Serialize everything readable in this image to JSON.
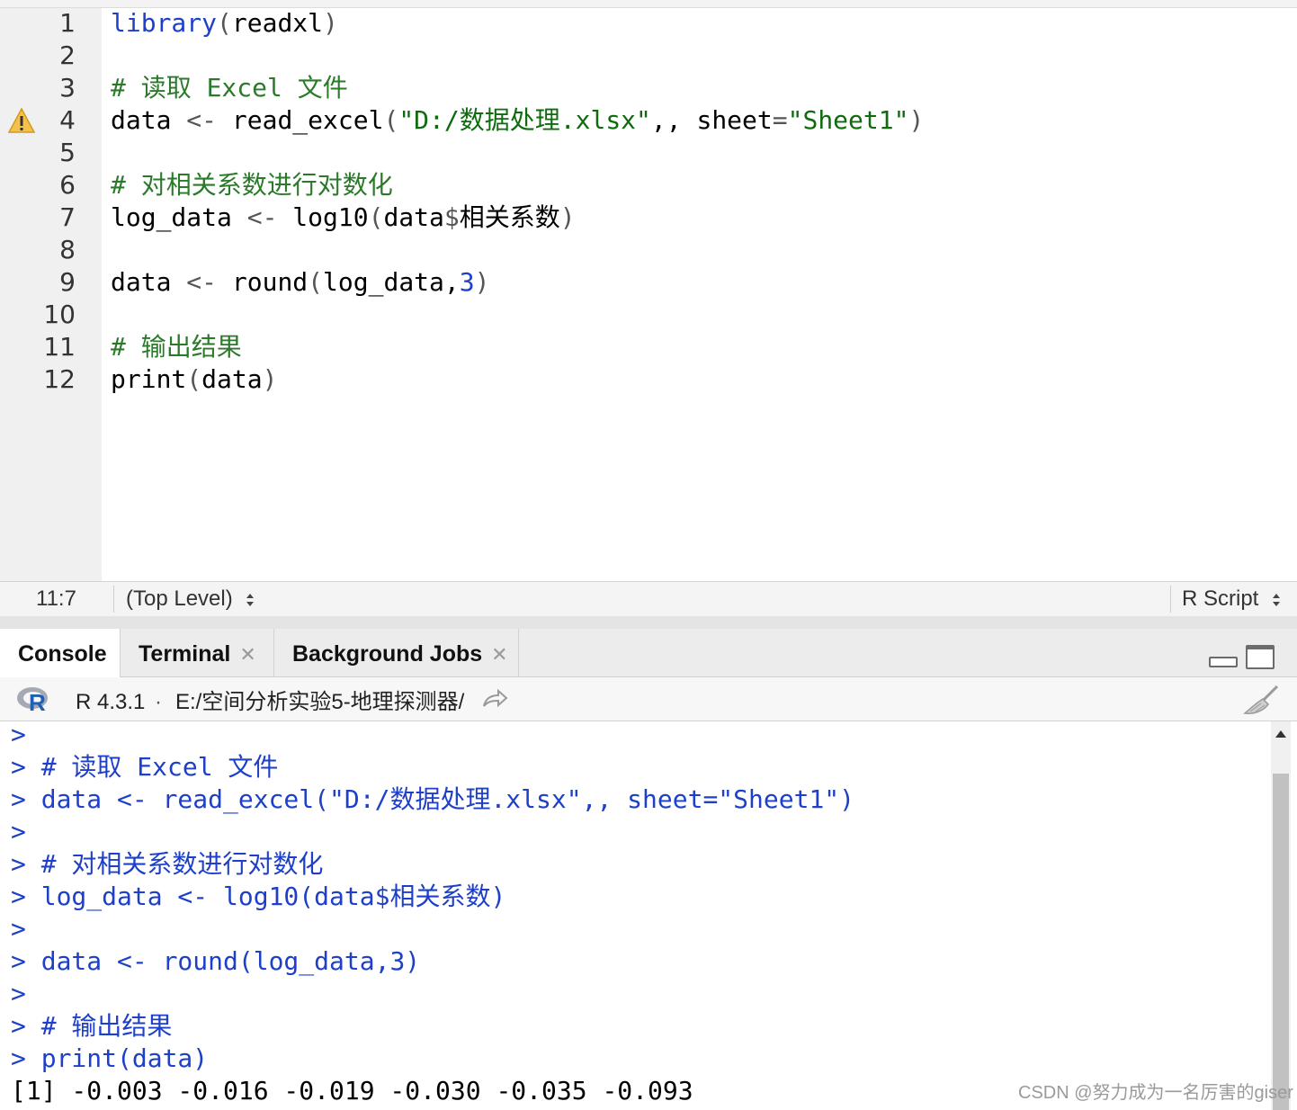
{
  "editor": {
    "lines": [
      {
        "n": "1",
        "tokens": [
          {
            "t": "library",
            "c": "fn"
          },
          {
            "t": "(",
            "c": "pn"
          },
          {
            "t": "readxl",
            "c": ""
          },
          {
            "t": ")",
            "c": "pn"
          }
        ]
      },
      {
        "n": "2",
        "tokens": []
      },
      {
        "n": "3",
        "tokens": [
          {
            "t": "# 读取 Excel 文件",
            "c": "cm"
          }
        ]
      },
      {
        "n": "4",
        "warning": true,
        "tokens": [
          {
            "t": "data ",
            "c": ""
          },
          {
            "t": "<-",
            "c": "op"
          },
          {
            "t": " read_excel",
            "c": ""
          },
          {
            "t": "(",
            "c": "pn"
          },
          {
            "t": "\"D:/数据处理.xlsx\"",
            "c": "str"
          },
          {
            "t": ",, sheet",
            "c": ""
          },
          {
            "t": "=",
            "c": "op"
          },
          {
            "t": "\"Sheet1\"",
            "c": "str"
          },
          {
            "t": ")",
            "c": "pn"
          }
        ]
      },
      {
        "n": "5",
        "tokens": []
      },
      {
        "n": "6",
        "tokens": [
          {
            "t": "# 对相关系数进行对数化",
            "c": "cm"
          }
        ]
      },
      {
        "n": "7",
        "tokens": [
          {
            "t": "log_data ",
            "c": ""
          },
          {
            "t": "<-",
            "c": "op"
          },
          {
            "t": " log10",
            "c": ""
          },
          {
            "t": "(",
            "c": "pn"
          },
          {
            "t": "data",
            "c": ""
          },
          {
            "t": "$",
            "c": "op"
          },
          {
            "t": "相关系数",
            "c": ""
          },
          {
            "t": ")",
            "c": "pn"
          }
        ]
      },
      {
        "n": "8",
        "tokens": []
      },
      {
        "n": "9",
        "tokens": [
          {
            "t": "data ",
            "c": ""
          },
          {
            "t": "<-",
            "c": "op"
          },
          {
            "t": " round",
            "c": ""
          },
          {
            "t": "(",
            "c": "pn"
          },
          {
            "t": "log_data,",
            "c": ""
          },
          {
            "t": "3",
            "c": "num"
          },
          {
            "t": ")",
            "c": "pn"
          }
        ]
      },
      {
        "n": "10",
        "tokens": []
      },
      {
        "n": "11",
        "tokens": [
          {
            "t": "# 输出结果",
            "c": "cm"
          }
        ]
      },
      {
        "n": "12",
        "tokens": [
          {
            "t": "print",
            "c": ""
          },
          {
            "t": "(",
            "c": "pn"
          },
          {
            "t": "data",
            "c": ""
          },
          {
            "t": ")",
            "c": "pn"
          }
        ]
      }
    ]
  },
  "statusbar": {
    "position": "11:7",
    "scope": "(Top Level)",
    "filetype": "R Script"
  },
  "console_tabs": [
    {
      "label": "Console",
      "active": true,
      "closable": false
    },
    {
      "label": "Terminal",
      "active": false,
      "closable": true
    },
    {
      "label": "Background Jobs",
      "active": false,
      "closable": true
    }
  ],
  "console_header": {
    "version": "R 4.3.1",
    "separator": "·",
    "path": "E:/空间分析实验5-地理探测器/"
  },
  "console_lines": [
    {
      "prompt": ">",
      "text": ""
    },
    {
      "prompt": ">",
      "text": " # 读取 Excel 文件"
    },
    {
      "prompt": ">",
      "text": " data <- read_excel(\"D:/数据处理.xlsx\",, sheet=\"Sheet1\")"
    },
    {
      "prompt": ">",
      "text": ""
    },
    {
      "prompt": ">",
      "text": " # 对相关系数进行对数化"
    },
    {
      "prompt": ">",
      "text": " log_data <- log10(data$相关系数)"
    },
    {
      "prompt": ">",
      "text": ""
    },
    {
      "prompt": ">",
      "text": " data <- round(log_data,3)"
    },
    {
      "prompt": ">",
      "text": ""
    },
    {
      "prompt": ">",
      "text": " # 输出结果"
    },
    {
      "prompt": ">",
      "text": " print(data)"
    },
    {
      "output": "[1] -0.003 -0.016 -0.019 -0.030 -0.035 -0.093"
    }
  ],
  "watermark": "CSDN @努力成为一名厉害的giser",
  "colors": {
    "comment": "#2a7a2a",
    "function": "#1d3fc9",
    "string": "#0e6b0e",
    "console_echo": "#1d3fc9"
  }
}
